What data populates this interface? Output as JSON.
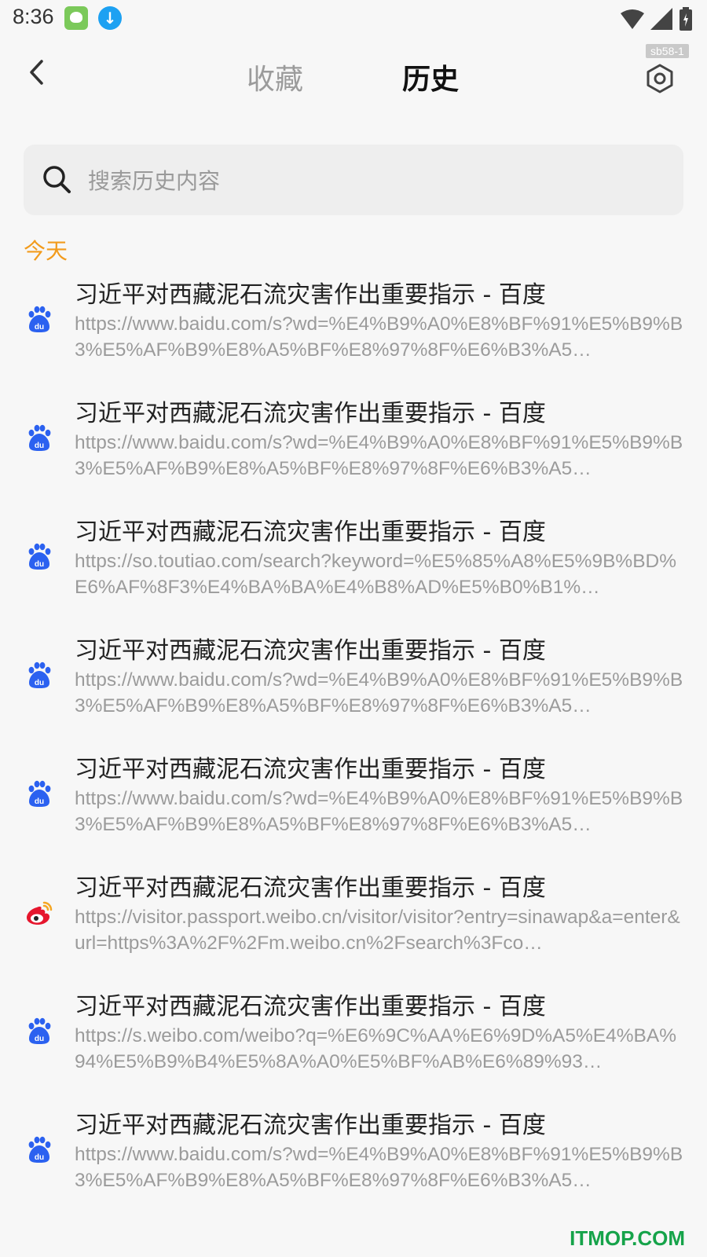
{
  "status_bar": {
    "time": "8:36"
  },
  "nav": {
    "tab_favorites": "收藏",
    "tab_history": "历史",
    "corner_tag": "sb58-1"
  },
  "search": {
    "placeholder": "搜索历史内容"
  },
  "section": {
    "today_label": "今天"
  },
  "history": [
    {
      "title": "习近平对西藏泥石流灾害作出重要指示 - 百度",
      "url": "https://www.baidu.com/s?wd=%E4%B9%A0%E8%BF%91%E5%B9%B3%E5%AF%B9%E8%A5%BF%E8%97%8F%E6%B3%A5…",
      "icon": "baidu-icon"
    },
    {
      "title": "习近平对西藏泥石流灾害作出重要指示 - 百度",
      "url": "https://www.baidu.com/s?wd=%E4%B9%A0%E8%BF%91%E5%B9%B3%E5%AF%B9%E8%A5%BF%E8%97%8F%E6%B3%A5…",
      "icon": "baidu-icon"
    },
    {
      "title": "习近平对西藏泥石流灾害作出重要指示 - 百度",
      "url": "https://so.toutiao.com/search?keyword=%E5%85%A8%E5%9B%BD%E6%AF%8F3%E4%BA%BA%E4%B8%AD%E5%B0%B1%…",
      "icon": "baidu-icon"
    },
    {
      "title": "习近平对西藏泥石流灾害作出重要指示 - 百度",
      "url": "https://www.baidu.com/s?wd=%E4%B9%A0%E8%BF%91%E5%B9%B3%E5%AF%B9%E8%A5%BF%E8%97%8F%E6%B3%A5…",
      "icon": "baidu-icon"
    },
    {
      "title": "习近平对西藏泥石流灾害作出重要指示 - 百度",
      "url": "https://www.baidu.com/s?wd=%E4%B9%A0%E8%BF%91%E5%B9%B3%E5%AF%B9%E8%A5%BF%E8%97%8F%E6%B3%A5…",
      "icon": "baidu-icon"
    },
    {
      "title": "习近平对西藏泥石流灾害作出重要指示 - 百度",
      "url": "https://visitor.passport.weibo.cn/visitor/visitor?entry=sinawap&a=enter&url=https%3A%2F%2Fm.weibo.cn%2Fsearch%3Fco…",
      "icon": "weibo-icon"
    },
    {
      "title": "习近平对西藏泥石流灾害作出重要指示 - 百度",
      "url": "https://s.weibo.com/weibo?q=%E6%9C%AA%E6%9D%A5%E4%BA%94%E5%B9%B4%E5%8A%A0%E5%BF%AB%E6%89%93…",
      "icon": "baidu-icon"
    },
    {
      "title": "习近平对西藏泥石流灾害作出重要指示 - 百度",
      "url": "https://www.baidu.com/s?wd=%E4%B9%A0%E8%BF%91%E5%B9%B3%E5%AF%B9%E8%A5%BF%E8%97%8F%E6%B3%A5…",
      "icon": "baidu-icon"
    }
  ],
  "watermark": "ITMOP.COM",
  "colors": {
    "accent": "#f29b1c",
    "baidu_blue": "#2b61f0",
    "weibo_red": "#e6162d"
  }
}
